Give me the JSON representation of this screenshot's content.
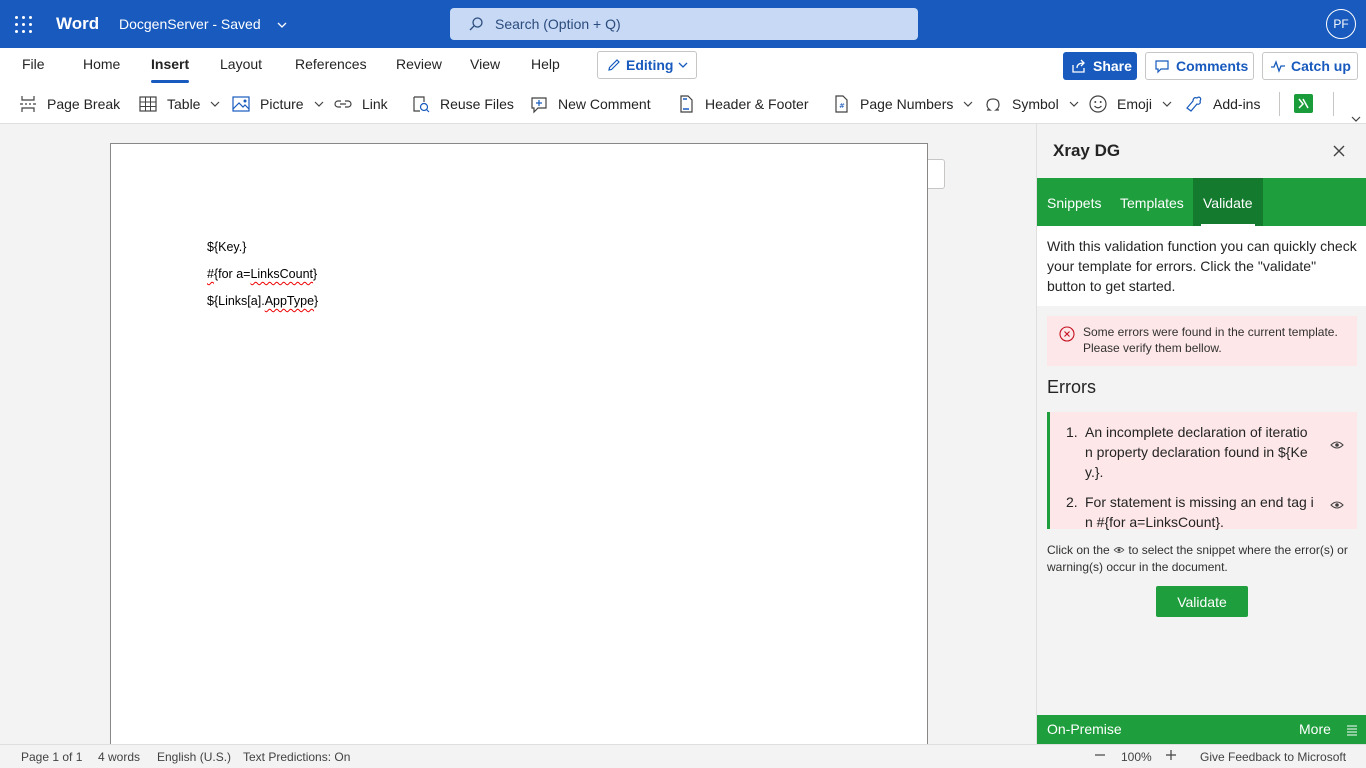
{
  "titlebar": {
    "app_name": "Word",
    "doc_title": "DocgenServer - Saved",
    "search_placeholder": "Search (Option + Q)",
    "avatar_initials": "PF"
  },
  "menu": {
    "items": [
      "File",
      "Home",
      "Insert",
      "Layout",
      "References",
      "Review",
      "View",
      "Help"
    ],
    "active": "Insert",
    "editing_label": "Editing",
    "share_label": "Share",
    "comments_label": "Comments",
    "catchup_label": "Catch up"
  },
  "ribbon": {
    "page_break": "Page Break",
    "table": "Table",
    "picture": "Picture",
    "link": "Link",
    "reuse_files": "Reuse Files",
    "new_comment": "New Comment",
    "header_footer": "Header & Footer",
    "page_numbers": "Page Numbers",
    "symbol": "Symbol",
    "emoji": "Emoji",
    "addins": "Add-ins"
  },
  "document": {
    "line1": "${Key.}",
    "line2_a": "#",
    "line2_b": "{for a=",
    "line2_c": "LinksCount",
    "line2_d": "}",
    "line3_a": "${Links[a].",
    "line3_b": "AppType",
    "line3_c": "}"
  },
  "panel": {
    "title": "Xray DG",
    "tabs": [
      "Snippets",
      "Templates",
      "Validate"
    ],
    "active_tab": "Validate",
    "intro": "With this validation function you can quickly check your template for errors. Click the \"validate\" button to get started.",
    "alert": "Some errors were found in the current template. Please verify them bellow.",
    "errors_heading": "Errors",
    "errors": [
      {
        "num": "1.",
        "text": "An incomplete declaration of iteration property declaration found in ${Key.}."
      },
      {
        "num": "2.",
        "text": "For statement is missing an end tag in #{for a=LinksCount}."
      }
    ],
    "help_before": "Click on the",
    "help_after": "to select the snippet where the error(s) or warning(s) occur in the document.",
    "validate_label": "Validate",
    "footer_left": "On-Premise",
    "footer_right": "More"
  },
  "status": {
    "page": "Page 1 of 1",
    "words": "4 words",
    "language": "English (U.S.)",
    "predictions": "Text Predictions: On",
    "zoom": "100%",
    "feedback": "Give Feedback to Microsoft"
  },
  "colors": {
    "word_blue": "#185abd",
    "xray_green": "#1e9e3c",
    "error_bg": "#fde7e9",
    "error_red": "#c50f1f"
  }
}
